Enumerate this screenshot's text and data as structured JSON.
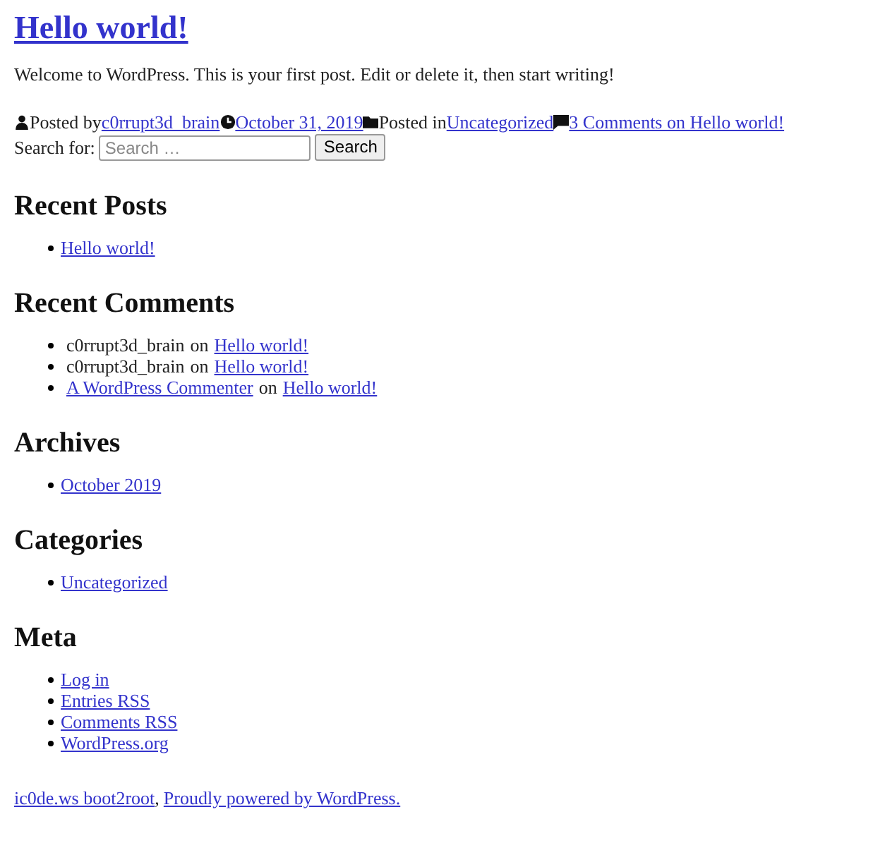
{
  "post": {
    "title": "Hello world!",
    "body": "Welcome to WordPress. This is your first post. Edit or delete it, then start writing!",
    "meta": {
      "posted_by_label": "Posted by",
      "author": "c0rrupt3d_brain",
      "date": "October 31, 2019",
      "posted_in_label": "Posted in",
      "category": "Uncategorized",
      "comments": "3 Comments on Hello world!"
    }
  },
  "search": {
    "label": "Search for:",
    "placeholder": "Search …",
    "button": "Search"
  },
  "widgets": [
    {
      "title": "Recent Posts",
      "items": [
        {
          "kind": "link",
          "text": "Hello world!"
        }
      ]
    },
    {
      "title": "Recent Comments",
      "items": [
        {
          "kind": "comment",
          "author": "c0rrupt3d_brain",
          "author_linked": false,
          "on": "on",
          "post": "Hello world!"
        },
        {
          "kind": "comment",
          "author": "c0rrupt3d_brain",
          "author_linked": false,
          "on": "on",
          "post": "Hello world!"
        },
        {
          "kind": "comment",
          "author": "A WordPress Commenter",
          "author_linked": true,
          "on": "on",
          "post": "Hello world!"
        }
      ]
    },
    {
      "title": "Archives",
      "items": [
        {
          "kind": "link",
          "text": "October 2019"
        }
      ]
    },
    {
      "title": "Categories",
      "items": [
        {
          "kind": "link",
          "text": "Uncategorized"
        }
      ]
    },
    {
      "title": "Meta",
      "items": [
        {
          "kind": "link",
          "text": "Log in"
        },
        {
          "kind": "link",
          "text": "Entries RSS"
        },
        {
          "kind": "link",
          "text": "Comments RSS"
        },
        {
          "kind": "link",
          "text": "WordPress.org"
        }
      ]
    }
  ],
  "footer": {
    "site": "ic0de.ws boot2root",
    "separator": ",",
    "powered": "Proudly powered by WordPress."
  }
}
